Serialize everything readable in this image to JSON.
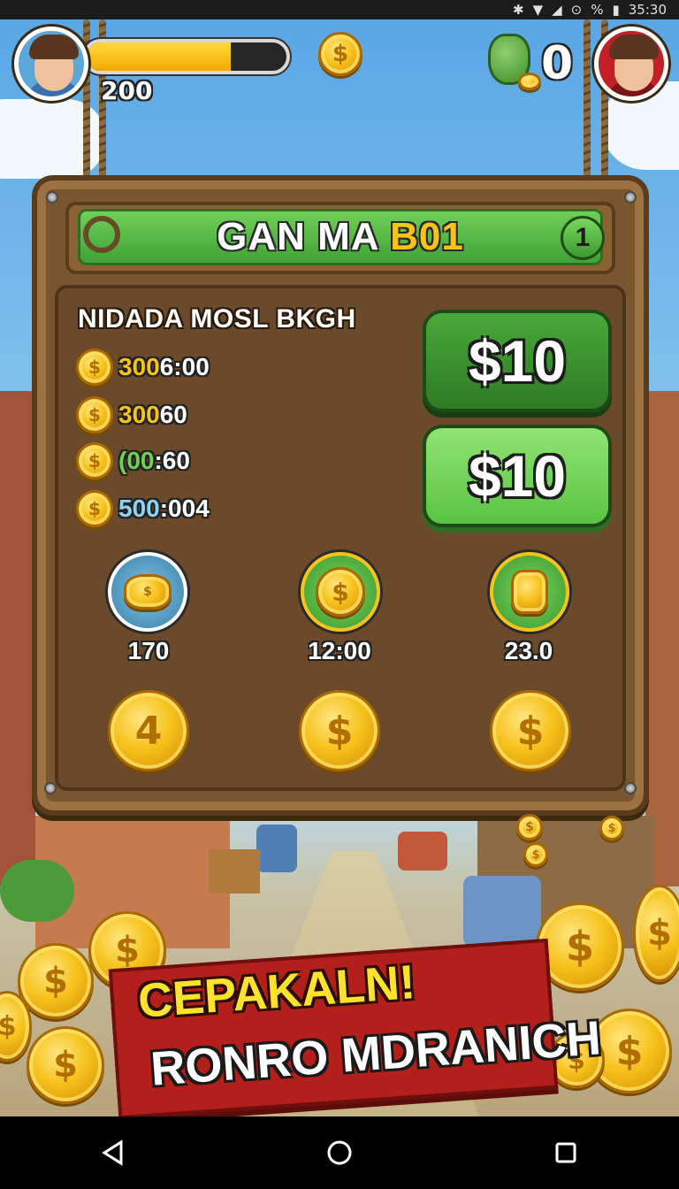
{
  "status_bar": {
    "time": "35:30",
    "battery_label": "%"
  },
  "hud": {
    "player_score": "200",
    "health_fraction": 0.72,
    "opponent_score": "0"
  },
  "board": {
    "title_main": "GAN MA ",
    "title_accent": "B01",
    "level": "1",
    "list_heading": "NIDADA MOSL BKGH",
    "rows": [
      {
        "highlight": "300",
        "rest": "6:00",
        "highlight_color": "#f6c21c"
      },
      {
        "highlight": "300",
        "rest": "60",
        "highlight_color": "#f6c21c"
      },
      {
        "highlight": "(00",
        "rest": ":60",
        "highlight_color": "#6fcf57"
      },
      {
        "highlight": "500",
        "rest": ":004",
        "highlight_color": "#8fd3f2"
      }
    ],
    "button_top": "$10",
    "button_bottom": "$10",
    "rewards": [
      {
        "label": "170",
        "icon": "coin-pile-icon"
      },
      {
        "label": "12:00",
        "icon": "dollar-coin-icon"
      },
      {
        "label": "23.0",
        "icon": "coin-stack-icon"
      }
    ],
    "big_coins": [
      "4",
      "$",
      "$"
    ]
  },
  "banner": {
    "line1": "CEPAKALN!",
    "line2": "RONRO MDRANICH"
  },
  "colors": {
    "accent_gold": "#f6c21c",
    "button_dark_green": "#2e7a24",
    "button_light_green": "#5ac442",
    "banner_red": "#b3201c"
  }
}
